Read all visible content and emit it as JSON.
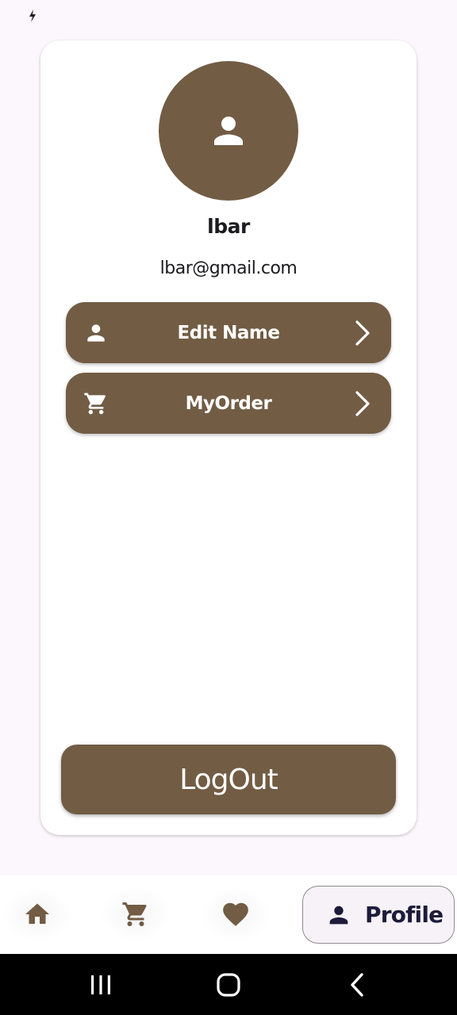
{
  "status_bar": {
    "icons": [
      "charging-bolt-icon"
    ]
  },
  "profile": {
    "avatar_icon": "person-icon",
    "name": "lbar",
    "email": "lbar@gmail.com"
  },
  "menu": {
    "edit_name": {
      "label": "Edit Name",
      "icon": "person-icon",
      "trailing_icon": "chevron-right-icon"
    },
    "my_order": {
      "label": "MyOrder",
      "icon": "cart-icon",
      "trailing_icon": "chevron-right-icon"
    }
  },
  "logout": {
    "label": "LogOut"
  },
  "bottom_nav": {
    "items": [
      {
        "icon": "home-icon"
      },
      {
        "icon": "cart-icon"
      },
      {
        "icon": "heart-icon"
      },
      {
        "icon": "person-icon",
        "label": "Profile",
        "selected": true
      }
    ]
  },
  "system_nav": {
    "buttons": [
      "recents-icon",
      "home-circle-icon",
      "back-icon"
    ]
  },
  "colors": {
    "accent": "#725c44",
    "background": "#fcf7fc",
    "card": "#ffffff",
    "text": "#1c1b1f"
  }
}
